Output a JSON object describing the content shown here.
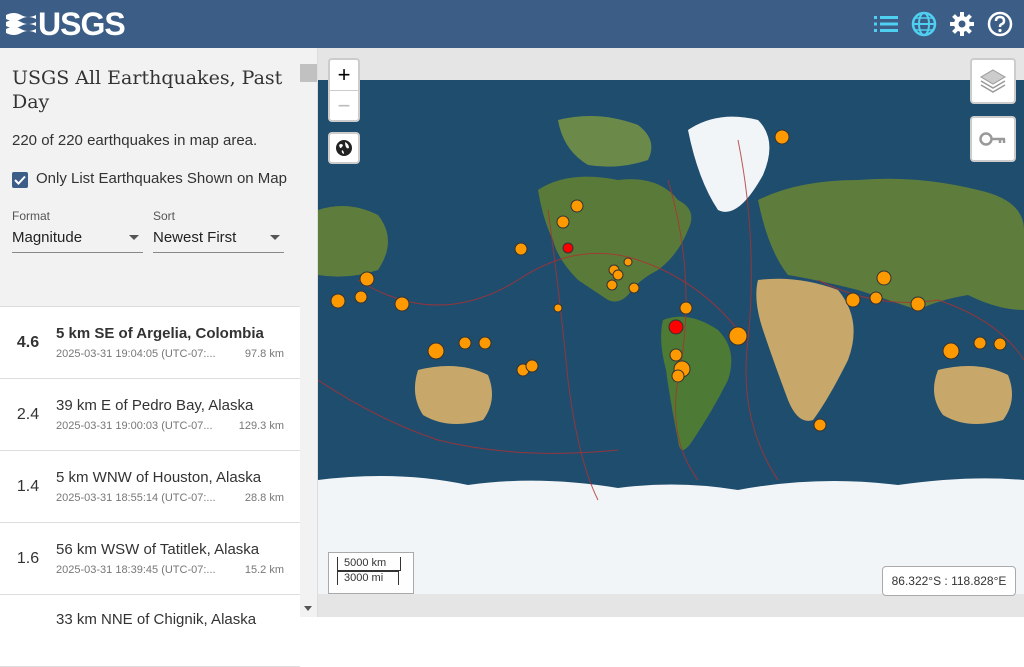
{
  "header": {
    "logo_text": "USGS",
    "icons": [
      "list-icon",
      "globe-icon",
      "gear-icon",
      "help-icon"
    ]
  },
  "sidebar": {
    "title": "USGS All Earthquakes, Past Day",
    "count_text": "220 of 220 earthquakes in map area.",
    "only_list_label": "Only List Earthquakes Shown on Map",
    "only_list_checked": true,
    "format": {
      "label": "Format",
      "value": "Magnitude"
    },
    "sort": {
      "label": "Sort",
      "value": "Newest First"
    }
  },
  "earthquakes": [
    {
      "mag": "4.6",
      "place": "5 km SE of Argelia, Colombia",
      "time": "2025-03-31 19:04:05 (UTC-07:...",
      "depth": "97.8 km"
    },
    {
      "mag": "2.4",
      "place": "39 km E of Pedro Bay, Alaska",
      "time": "2025-03-31 19:00:03 (UTC-07...",
      "depth": "129.3 km"
    },
    {
      "mag": "1.4",
      "place": "5 km WNW of Houston, Alaska",
      "time": "2025-03-31 18:55:14 (UTC-07:...",
      "depth": "28.8 km"
    },
    {
      "mag": "1.6",
      "place": "56 km WSW of Tatitlek, Alaska",
      "time": "2025-03-31 18:39:45 (UTC-07:...",
      "depth": "15.2 km"
    },
    {
      "mag": "",
      "place": "33 km NNE of Chignik, Alaska",
      "time": "",
      "depth": ""
    }
  ],
  "map": {
    "zoom_in": "+",
    "zoom_out": "−",
    "scale_km": "5000 km",
    "scale_mi": "3000 mi",
    "coordinates": "86.322°S : 118.828°E",
    "colors": {
      "ocean": "#1f4d6e",
      "land": "#5a7a3a",
      "ice": "#f2f5f7",
      "desert": "#c8a86a",
      "quake": "#ff9900",
      "quake_recent": "#ff0000",
      "plate": "#b03030"
    }
  }
}
